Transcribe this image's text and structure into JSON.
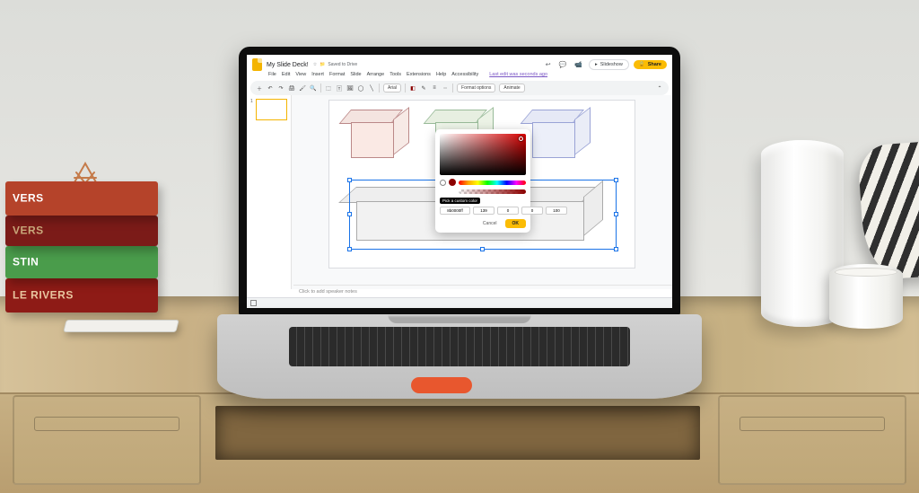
{
  "books": {
    "b1": "LE RIVERS",
    "b2": "STIN",
    "b3": "VERS",
    "b4": "VERS"
  },
  "doc": {
    "title": "My Slide Deck!",
    "saved_badge": "Saved to Drive"
  },
  "header": {
    "slideshow": "Slideshow",
    "share": "Share"
  },
  "menu": {
    "file": "File",
    "edit": "Edit",
    "view": "View",
    "insert": "Insert",
    "format": "Format",
    "slide": "Slide",
    "arrange": "Arrange",
    "tools": "Tools",
    "extensions": "Extensions",
    "help": "Help",
    "accessibility": "Accessibility",
    "hint": "Last edit was seconds ago"
  },
  "toolbar": {
    "font": "Arial",
    "format_options": "Format options",
    "animate": "Animate"
  },
  "thumbs": {
    "n1": "1"
  },
  "notes_placeholder": "Click to add speaker notes",
  "picker": {
    "label": "Pick a custom color",
    "hex": "8b0000ff",
    "r": "139",
    "g": "0",
    "b": "0",
    "a": "100",
    "cancel": "Cancel",
    "ok": "OK"
  }
}
